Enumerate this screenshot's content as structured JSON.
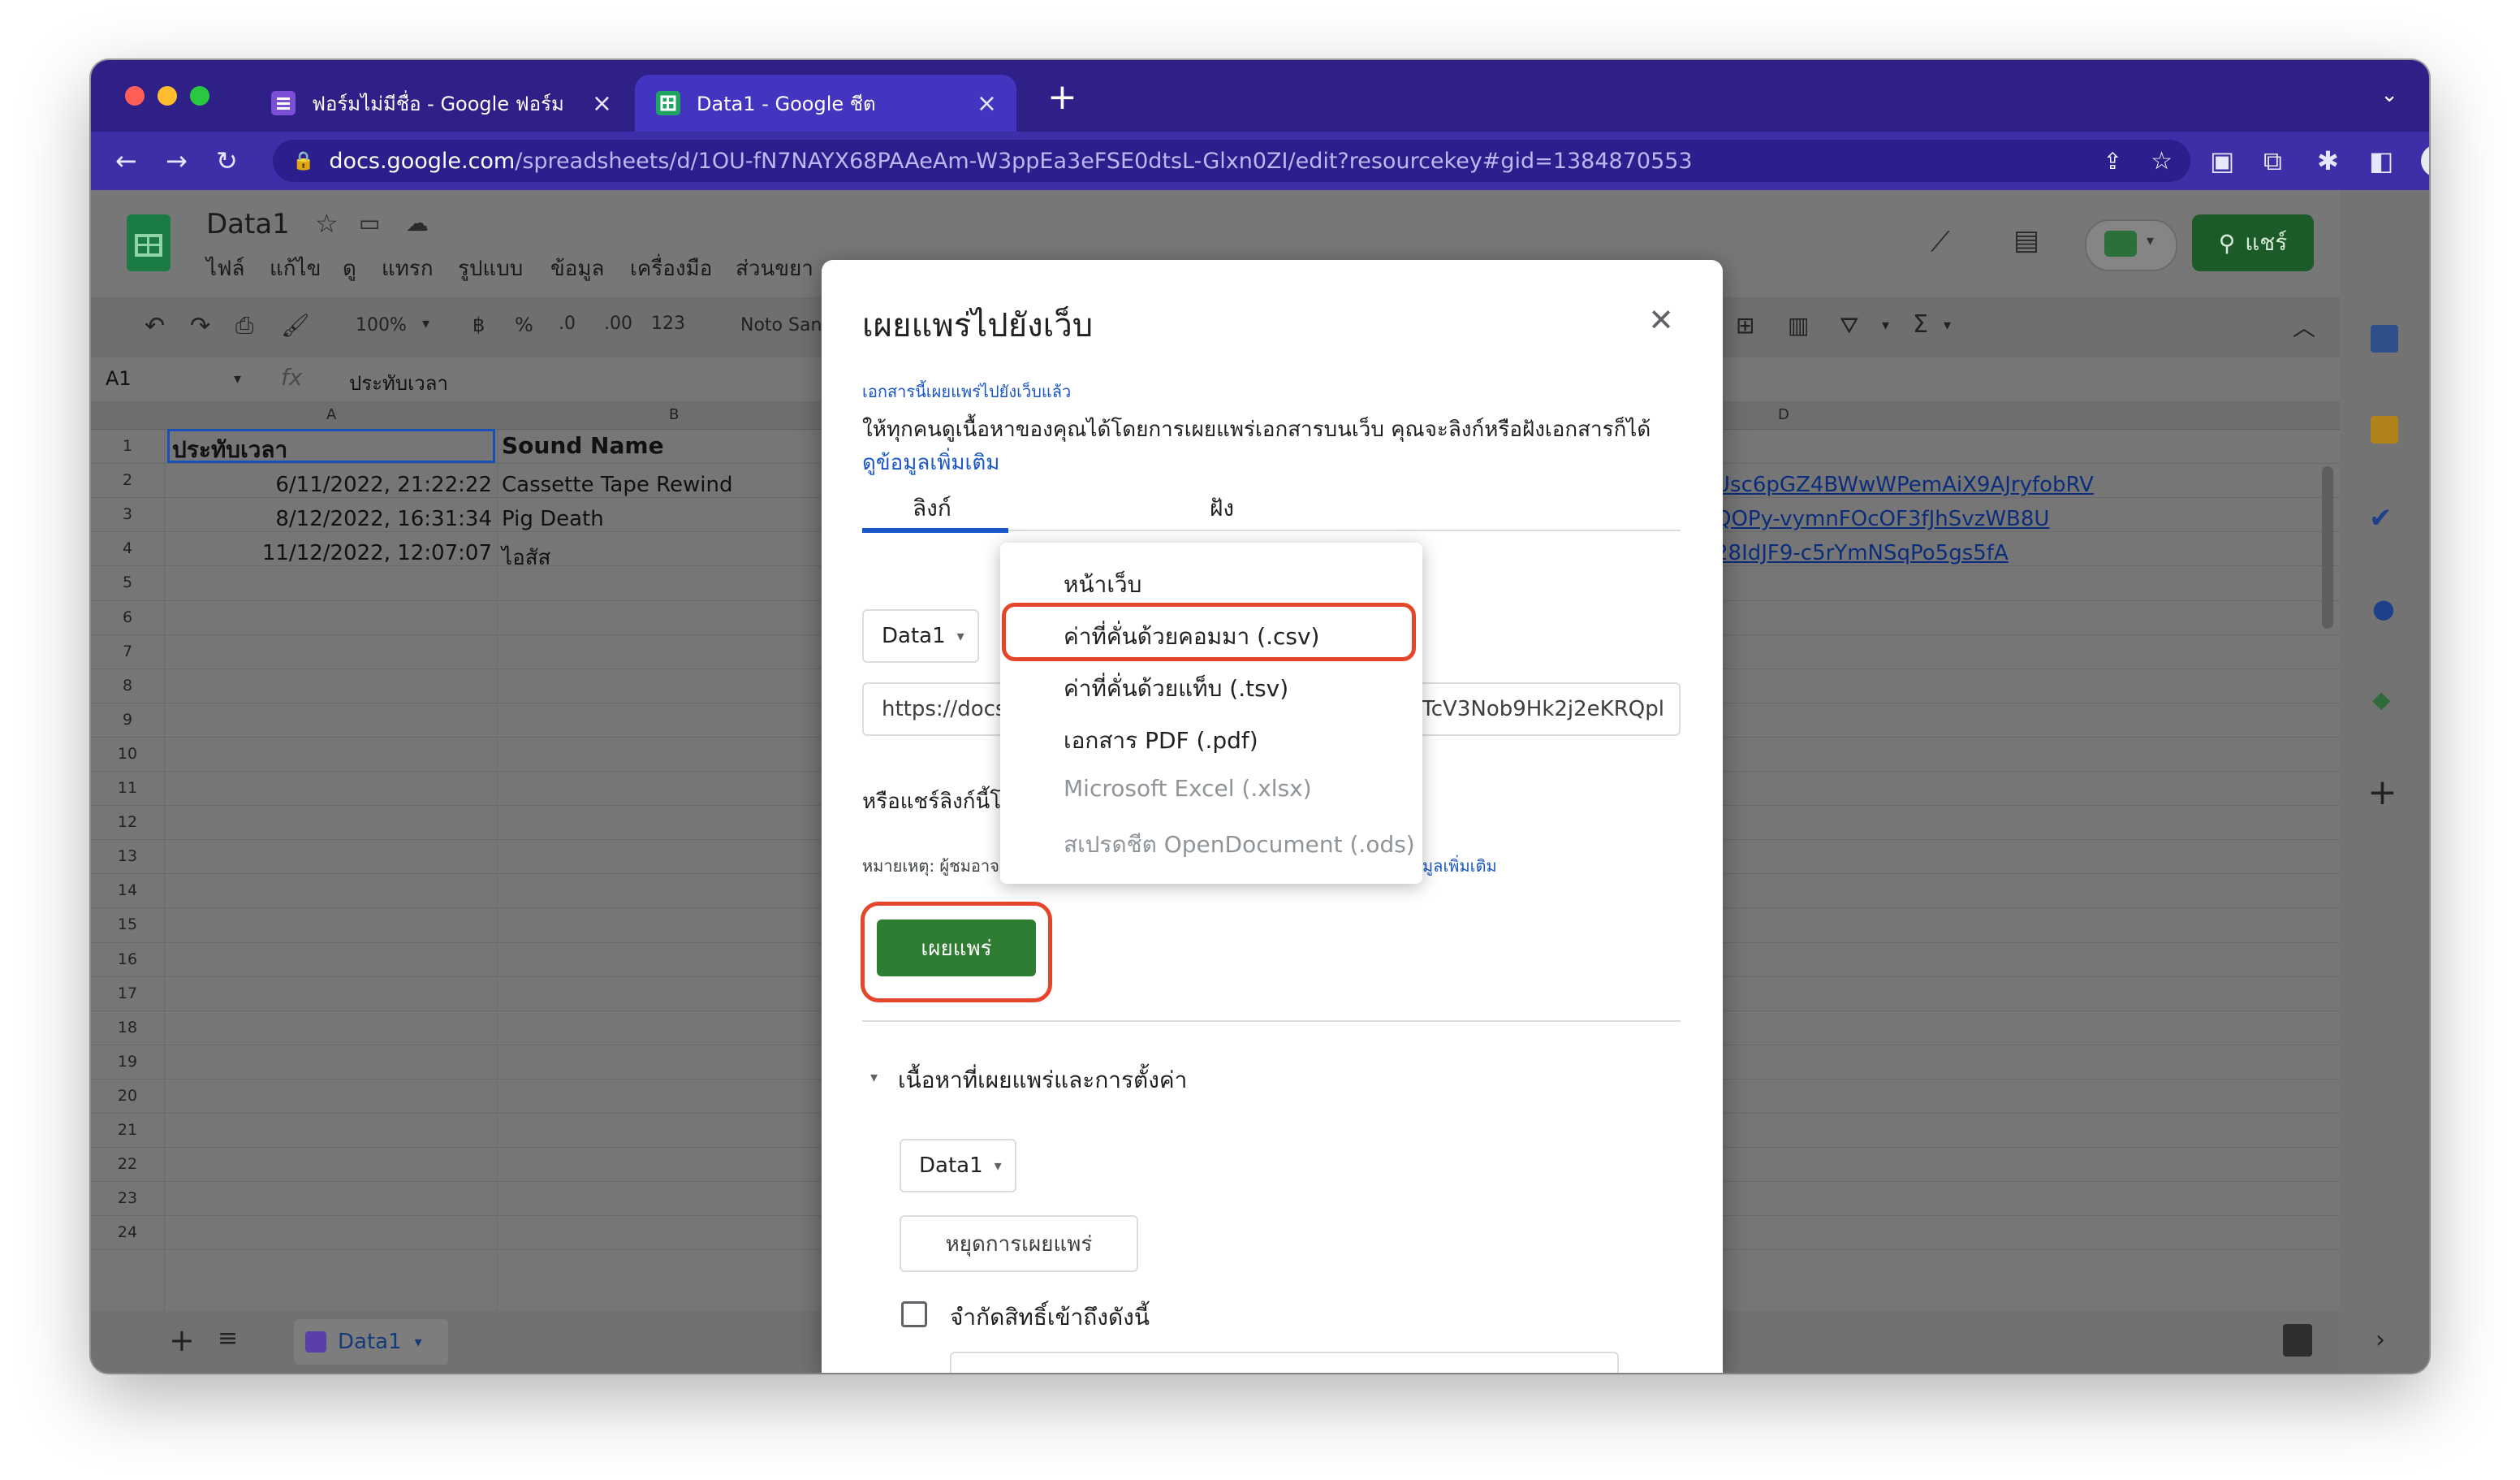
{
  "browser": {
    "tabs": [
      {
        "title": "ฟอร์มไม่มีชื่อ - Google ฟอร์ม"
      },
      {
        "title": "Data1 - Google ชีต"
      }
    ],
    "url_host": "docs.google.com",
    "url_path": "/spreadsheets/d/1OU-fN7NAYX68PAAeAm-W3ppEa3eFSE0dtsL-Glxn0ZI/edit?resourcekey#gid=1384870553"
  },
  "sheets": {
    "doc_title": "Data1",
    "menu": [
      "ไฟล์",
      "แก้ไข",
      "ดู",
      "แทรก",
      "รูปแบบ",
      "ข้อมูล",
      "เครื่องมือ",
      "ส่วนขยา"
    ],
    "share_label": "แชร์",
    "toolbar": {
      "zoom": "100%",
      "currency": "฿",
      "percent": "%",
      "dec_less": ".0",
      "dec_more": ".00",
      "num_format": "123",
      "font": "Noto San"
    },
    "name_box": "A1",
    "formula": "ประทับเวลา",
    "columns": [
      "A",
      "B",
      "D"
    ],
    "rows": [
      "1",
      "2",
      "3",
      "4",
      "5",
      "6",
      "7",
      "8",
      "9",
      "10",
      "11",
      "12",
      "13",
      "14",
      "15",
      "16",
      "17",
      "18",
      "19",
      "20",
      "21",
      "22",
      "23",
      "24"
    ],
    "header": {
      "a": "ประทับเวลา",
      "b": "Sound Name"
    },
    "data": [
      {
        "a": "6/11/2022, 21:22:22",
        "b": "Cassette Tape Rewind",
        "d": "Usc6pGZ4BWwWPemAiX9AJryfobRV"
      },
      {
        "a": "8/12/2022, 16:31:34",
        "b": "Pig Death",
        "d": "QOPy-vymnFOcOF3fJhSvzWB8U"
      },
      {
        "a": "11/12/2022, 12:07:07",
        "b": "ไอสัส",
        "d": "28IdJF9-c5rYmNSqPo5gs5fA"
      }
    ],
    "sheet_tab": "Data1"
  },
  "dialog": {
    "title": "เผยแพร่ไปยังเว็บ",
    "published_note": "เอกสารนี้เผยแพร่ไปยังเว็บแล้ว",
    "description": "ให้ทุกคนดูเนื้อหาของคุณได้โดยการเผยแพร่เอกสารบนเว็บ คุณจะลิงก์หรือฝังเอกสารก็ได้",
    "learn_more": "ดูข้อมูลเพิ่มเติม",
    "tab_link": "ลิงก์",
    "tab_embed": "ฝัง",
    "sheet_select": "Data1",
    "link_start": "https://docs.",
    "link_end": "TcV3Nob9Hk2j2eKRQpl",
    "share_via": "หรือแชร์ลิงก์นี้โ",
    "note_prefix": "หมายเหตุ: ผู้ชมอาจ",
    "note_link": "มูลเพิ่มเติม",
    "publish_button": "เผยแพร่",
    "section_title": "เนื้อหาที่เผยแพร่และการตั้งค่า",
    "content_select": "Data1",
    "stop_button": "หยุดการเผยแพร่",
    "restrict_label": "จำกัดสิทธิ์เข้าถึงดังนี้"
  },
  "format_menu": {
    "items": [
      {
        "label": "หน้าเว็บ"
      },
      {
        "label": "ค่าที่คั่นด้วยคอมมา (.csv)"
      },
      {
        "label": "ค่าที่คั่นด้วยแท็บ (.tsv)"
      },
      {
        "label": "เอกสาร PDF (.pdf)"
      },
      {
        "label": "Microsoft Excel (.xlsx)"
      },
      {
        "label": "สเปรดชีต OpenDocument (.ods)"
      }
    ],
    "selected": 1
  },
  "colors": {
    "highlight": "#e5462b",
    "publish_green": "#2e7d32",
    "tab_active": "#4335c0"
  }
}
